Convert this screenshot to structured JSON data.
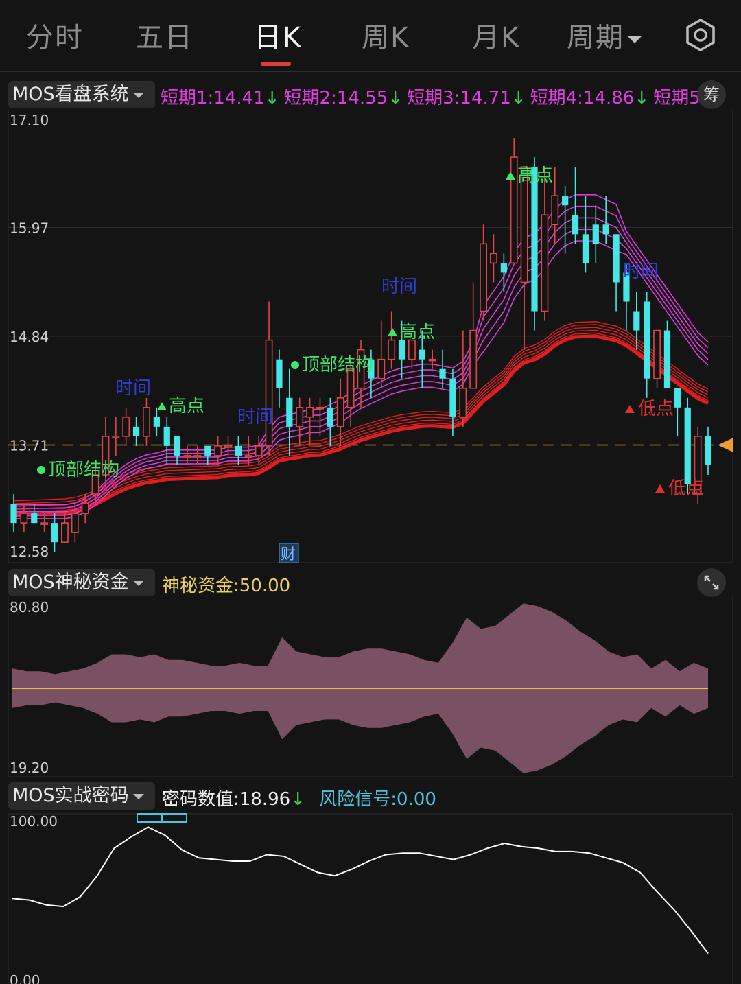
{
  "tabs": [
    {
      "label": "分时",
      "active": false
    },
    {
      "label": "五日",
      "active": false
    },
    {
      "label": "日K",
      "active": true
    },
    {
      "label": "周K",
      "active": false
    },
    {
      "label": "月K",
      "active": false
    },
    {
      "label": "周期",
      "active": false
    }
  ],
  "main_panel": {
    "indicator": "MOS看盘系统",
    "legend": [
      {
        "label": "短期1:",
        "value": "14.41",
        "arrow": "↓"
      },
      {
        "label": "短期2:",
        "value": "14.55",
        "arrow": "↓"
      },
      {
        "label": "短期3:",
        "value": "14.71",
        "arrow": "↓"
      },
      {
        "label": "短期4:",
        "value": "14.86",
        "arrow": "↓"
      },
      {
        "label": "短期5",
        "value": "",
        "arrow": ""
      }
    ],
    "side_badge": "筹",
    "y_labels": [
      "17.10",
      "15.97",
      "14.84",
      "13.71",
      "12.58"
    ],
    "annotations": {
      "top_structure": "顶部结构",
      "high": "高点",
      "time": "时间",
      "low": "低点",
      "finance": "财"
    }
  },
  "fund_panel": {
    "indicator": "MOS神秘资金",
    "legend_label": "神秘资金:",
    "legend_value": "50.00",
    "y_labels": [
      "80.80",
      "19.20"
    ]
  },
  "code_panel": {
    "indicator": "MOS实战密码",
    "legend_label": "密码数值:",
    "legend_value": "18.96",
    "legend_arrow": "↓",
    "risk_label": "风险信号:",
    "risk_value": "0.00",
    "y_labels": [
      "100.00",
      "0.00"
    ]
  },
  "colors": {
    "up": "#e04646",
    "down": "#46e6e6",
    "ma_short": "#d93ad9",
    "ma_long": "#e01e1e",
    "fund": "#7a5164",
    "code_line": "#ffffff",
    "guide": "#f0a030"
  },
  "chart_data": [
    {
      "type": "candlestick",
      "title": "MOS看盘系统",
      "ylim": [
        12.58,
        17.1
      ],
      "y_ticks": [
        17.1,
        15.97,
        14.84,
        13.71,
        12.58
      ],
      "reference_price": 13.71,
      "candles": [
        [
          13.1,
          12.9,
          13.2,
          12.8
        ],
        [
          12.9,
          13.0,
          13.1,
          12.8
        ],
        [
          13.0,
          12.9,
          13.1,
          12.9
        ],
        [
          12.9,
          12.9,
          13.0,
          12.8
        ],
        [
          12.9,
          12.7,
          13.0,
          12.6
        ],
        [
          12.7,
          12.9,
          13.0,
          12.7
        ],
        [
          12.8,
          13.0,
          13.1,
          12.7
        ],
        [
          13.0,
          13.1,
          13.2,
          12.9
        ],
        [
          13.2,
          13.4,
          13.5,
          13.1
        ],
        [
          13.4,
          13.8,
          14.0,
          13.3
        ],
        [
          13.8,
          13.8,
          14.0,
          13.6
        ],
        [
          13.8,
          14.0,
          14.1,
          13.7
        ],
        [
          13.9,
          13.8,
          14.0,
          13.7
        ],
        [
          13.8,
          14.1,
          14.2,
          13.7
        ],
        [
          14.0,
          13.9,
          14.1,
          13.8
        ],
        [
          13.9,
          13.7,
          14.0,
          13.5
        ],
        [
          13.8,
          13.6,
          13.8,
          13.5
        ],
        [
          13.6,
          13.6,
          13.7,
          13.5
        ],
        [
          13.6,
          13.6,
          13.7,
          13.5
        ],
        [
          13.7,
          13.6,
          13.7,
          13.5
        ],
        [
          13.6,
          13.7,
          13.8,
          13.5
        ],
        [
          13.7,
          13.7,
          13.8,
          13.6
        ],
        [
          13.7,
          13.6,
          13.8,
          13.5
        ],
        [
          13.6,
          13.6,
          13.8,
          13.5
        ],
        [
          13.6,
          13.7,
          13.8,
          13.5
        ],
        [
          13.7,
          14.8,
          15.2,
          13.6
        ],
        [
          14.6,
          14.3,
          14.7,
          14.1
        ],
        [
          14.2,
          13.9,
          14.5,
          13.6
        ],
        [
          13.9,
          14.1,
          14.2,
          13.7
        ],
        [
          14.0,
          14.1,
          14.2,
          13.7
        ],
        [
          14.1,
          14.1,
          14.2,
          13.8
        ],
        [
          14.1,
          13.9,
          14.2,
          13.7
        ],
        [
          13.9,
          14.2,
          14.4,
          13.7
        ],
        [
          14.1,
          14.5,
          14.6,
          13.9
        ],
        [
          14.3,
          14.7,
          14.8,
          14.1
        ],
        [
          14.6,
          14.4,
          14.7,
          14.2
        ],
        [
          14.4,
          14.6,
          15.0,
          14.3
        ],
        [
          14.6,
          14.8,
          15.1,
          14.5
        ],
        [
          14.8,
          14.6,
          15.0,
          14.4
        ],
        [
          14.6,
          14.8,
          14.8,
          14.5
        ],
        [
          14.7,
          14.6,
          14.9,
          14.3
        ],
        [
          14.6,
          14.6,
          14.7,
          14.5
        ],
        [
          14.5,
          14.4,
          14.7,
          14.3
        ],
        [
          14.4,
          14.0,
          14.5,
          13.8
        ],
        [
          14.0,
          14.3,
          14.9,
          13.9
        ],
        [
          14.3,
          14.9,
          15.4,
          14.3
        ],
        [
          15.1,
          15.8,
          16.0,
          15.0
        ],
        [
          15.6,
          15.7,
          15.9,
          15.4
        ],
        [
          15.6,
          15.5,
          15.7,
          15.3
        ],
        [
          15.6,
          16.7,
          16.9,
          15.6
        ],
        [
          15.4,
          16.6,
          16.6,
          14.7
        ],
        [
          16.6,
          15.1,
          16.7,
          14.9
        ],
        [
          15.1,
          16.1,
          16.6,
          15.0
        ],
        [
          16.0,
          16.3,
          16.6,
          15.8
        ],
        [
          16.3,
          16.2,
          16.4,
          15.7
        ],
        [
          16.1,
          15.9,
          16.6,
          15.8
        ],
        [
          15.9,
          15.6,
          16.3,
          15.5
        ],
        [
          16.0,
          15.8,
          16.2,
          15.6
        ],
        [
          16.0,
          15.9,
          16.3,
          15.8
        ],
        [
          15.9,
          15.4,
          15.9,
          15.1
        ],
        [
          15.5,
          15.2,
          15.6,
          14.9
        ],
        [
          15.1,
          14.9,
          15.3,
          14.7
        ],
        [
          15.2,
          14.4,
          15.3,
          14.2
        ],
        [
          14.4,
          14.9,
          14.9,
          14.3
        ],
        [
          14.9,
          14.3,
          15.0,
          14.3
        ],
        [
          14.3,
          14.1,
          14.3,
          13.8
        ],
        [
          14.1,
          13.3,
          14.2,
          13.2
        ],
        [
          13.2,
          13.8,
          13.9,
          13.1
        ],
        [
          13.8,
          13.5,
          13.9,
          13.4
        ]
      ],
      "series": [
        {
          "values": [
            12.98,
            12.98,
            12.98,
            12.98,
            12.98,
            12.98,
            13.0,
            13.05,
            13.12,
            13.22,
            13.32,
            13.4,
            13.46,
            13.5,
            13.52,
            13.55,
            13.55,
            13.55,
            13.55,
            13.55,
            13.55,
            13.58,
            13.58,
            13.58,
            13.6,
            13.7,
            13.82,
            13.85,
            13.87,
            13.9,
            13.9,
            13.95,
            14.0,
            14.08,
            14.15,
            14.2,
            14.25,
            14.3,
            14.33,
            14.35,
            14.37,
            14.37,
            14.35,
            14.33,
            14.4,
            14.6,
            14.8,
            14.95,
            15.1,
            15.35,
            15.5,
            15.55,
            15.65,
            15.8,
            15.9,
            15.95,
            15.95,
            15.95,
            15.9,
            15.85,
            15.75,
            15.6,
            15.45,
            15.3,
            15.15,
            15.0,
            14.85,
            14.7,
            14.6
          ]
        }
      ]
    },
    {
      "type": "area",
      "title": "MOS神秘资金",
      "ylim": [
        19.2,
        80.8
      ],
      "midline": 50.0,
      "values": [
        57,
        56,
        56,
        55,
        56,
        57,
        59,
        62,
        62,
        61,
        62,
        60,
        60,
        59,
        58,
        58,
        59,
        58,
        58,
        68,
        63,
        62,
        61,
        61,
        63,
        64,
        64,
        63,
        62,
        60,
        59,
        66,
        75,
        71,
        72,
        76,
        80,
        79,
        77,
        74,
        70,
        67,
        63,
        61,
        62,
        57,
        60,
        56,
        59,
        57
      ]
    },
    {
      "type": "line",
      "title": "MOS实战密码",
      "ylim": [
        0,
        100
      ],
      "values": [
        52,
        51,
        48,
        47,
        53,
        66,
        83,
        90,
        96,
        91,
        82,
        77,
        76,
        75,
        75,
        79,
        78,
        73,
        68,
        66,
        70,
        75,
        79,
        80,
        80,
        78,
        76,
        79,
        83,
        86,
        84,
        83,
        81,
        81,
        80,
        77,
        74,
        68,
        56,
        45,
        32,
        18
      ]
    }
  ]
}
